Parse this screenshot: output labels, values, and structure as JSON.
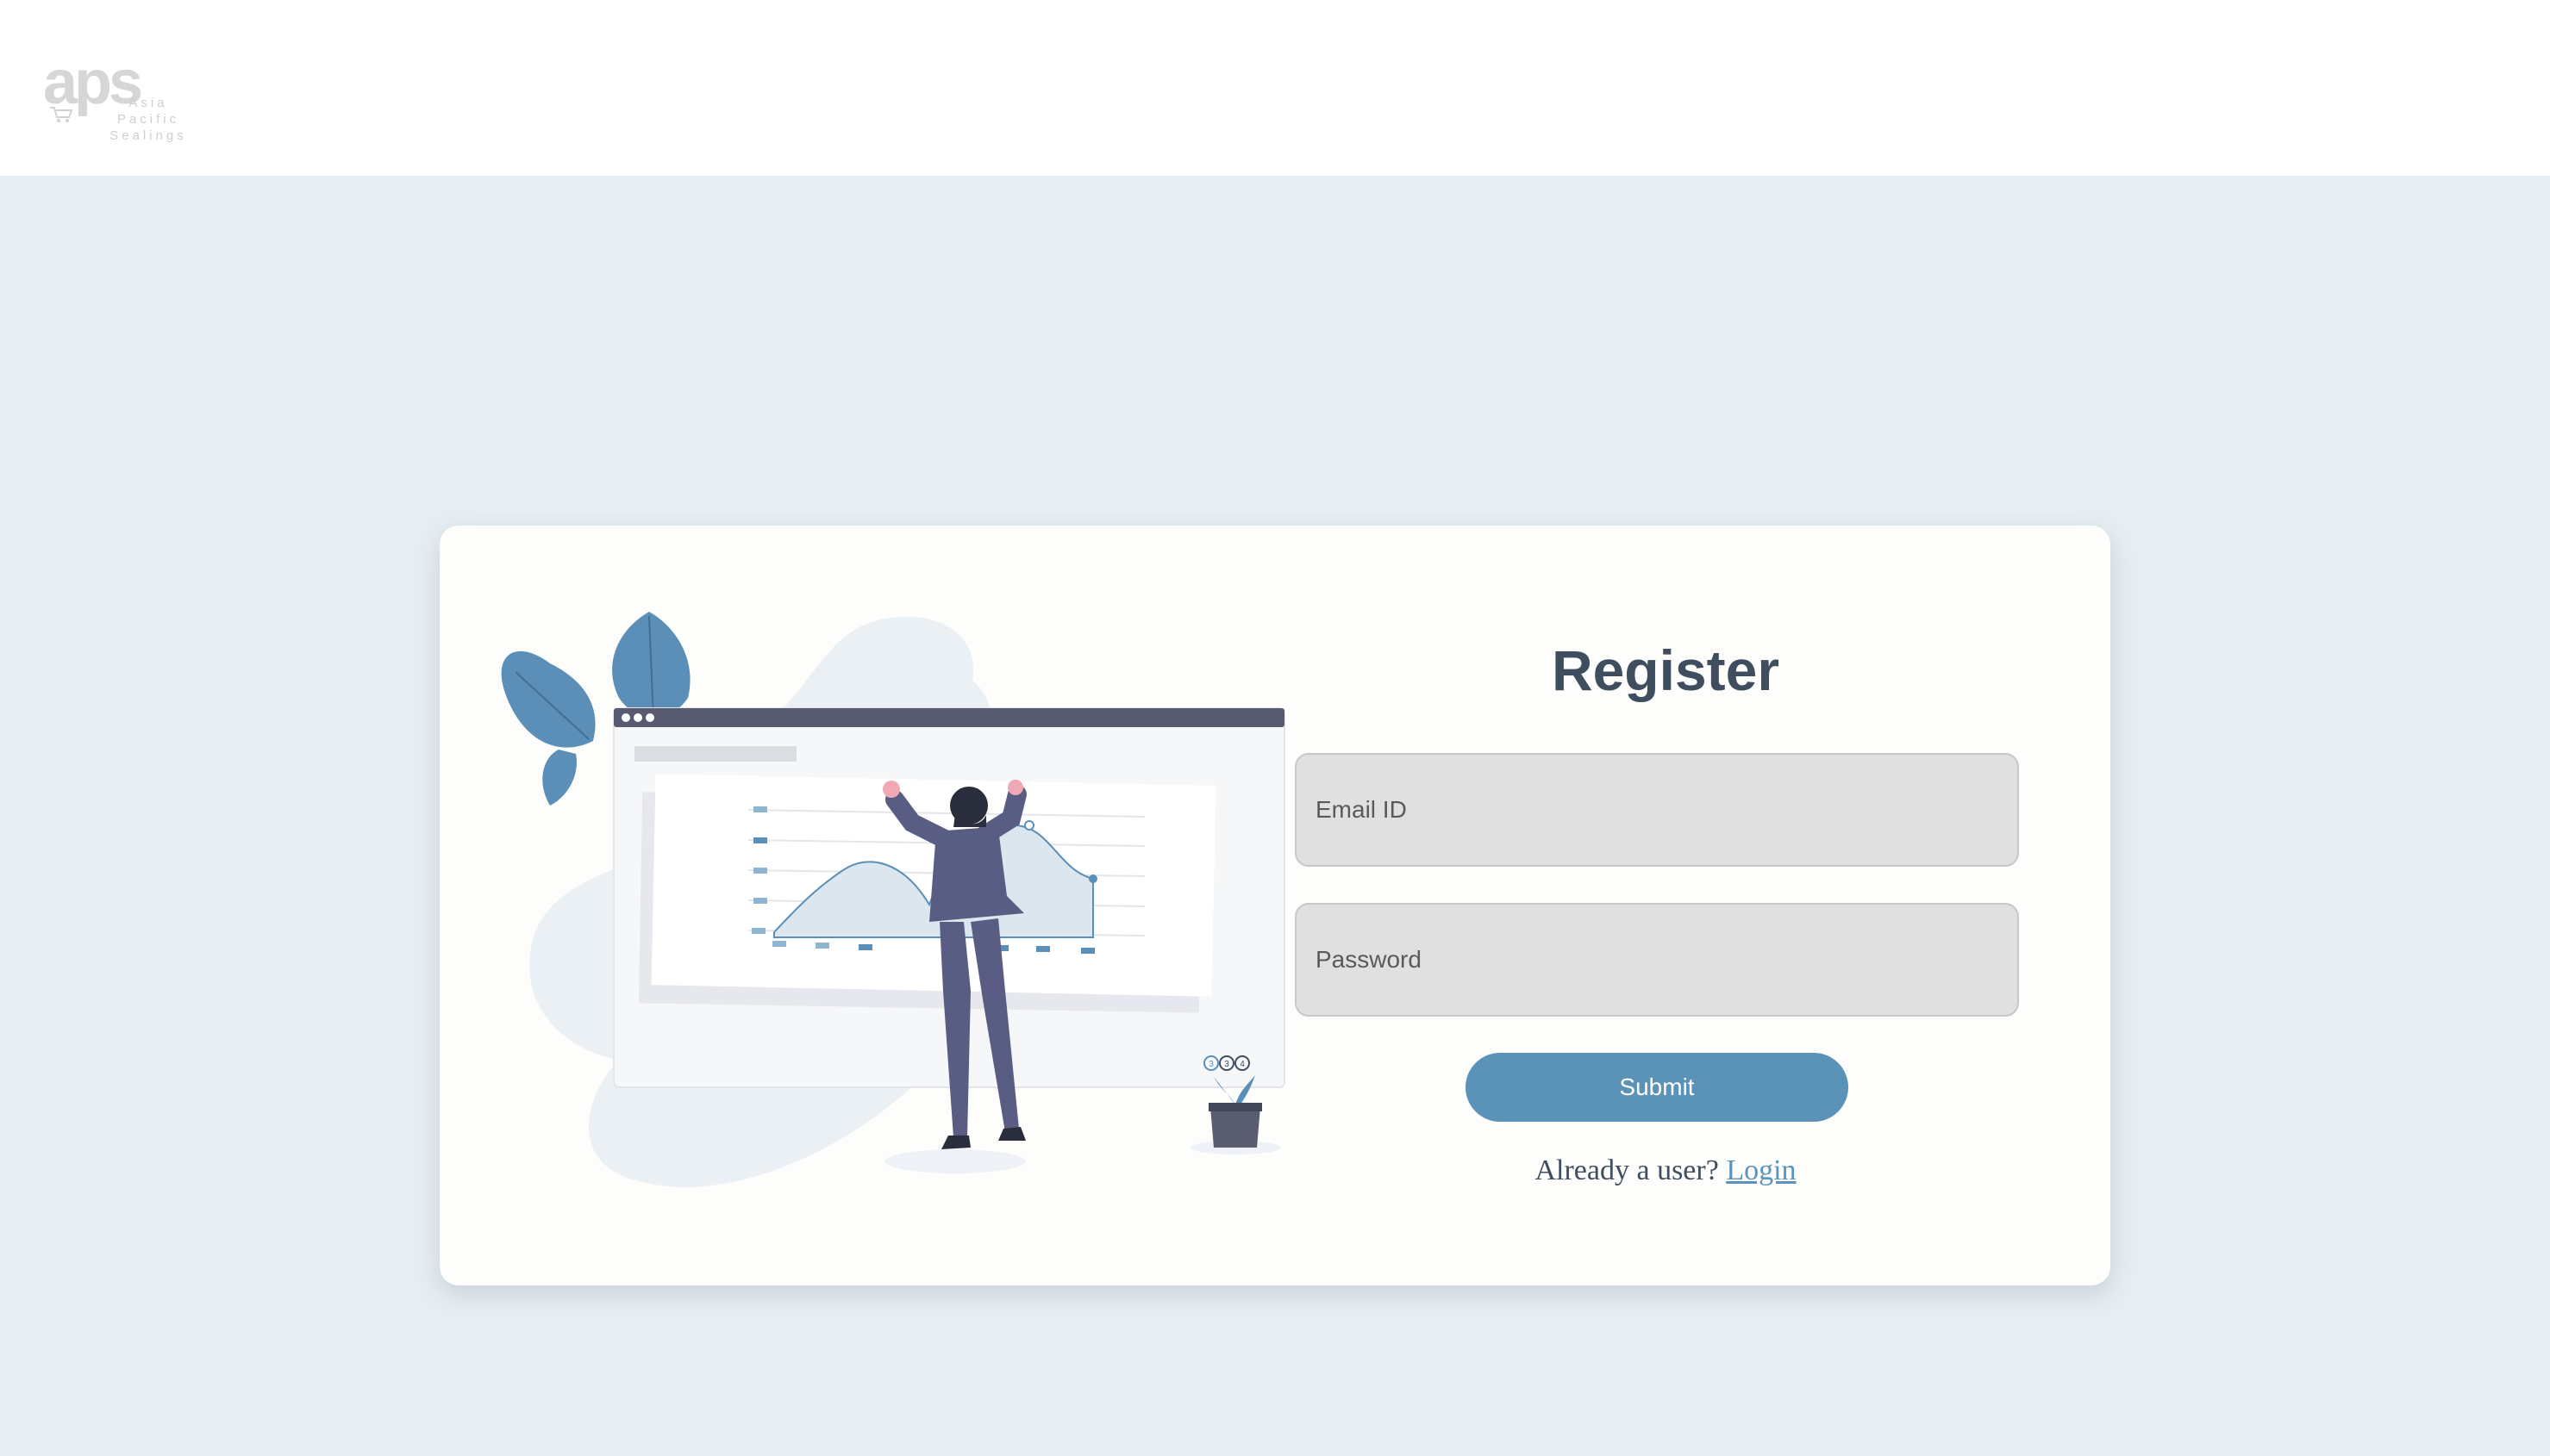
{
  "header": {
    "logo_mark": "aps",
    "logo_tagline_line1": "Asia Pacific",
    "logo_tagline_line2": "Sealings"
  },
  "form": {
    "title": "Register",
    "email_placeholder": "Email ID",
    "password_placeholder": "Password",
    "submit_label": "Submit",
    "already_user_text": "Already a user?",
    "login_link": "Login"
  },
  "illustration": {
    "description_icon": "analytics-dashboard-illustration",
    "page_dots": [
      "3",
      "3",
      "4"
    ]
  },
  "colors": {
    "page_background": "#e6eef2",
    "card_background": "#fdfdfb",
    "accent": "#5b93b8",
    "title": "#3f4e5f",
    "field_background": "#e0e0e0"
  }
}
